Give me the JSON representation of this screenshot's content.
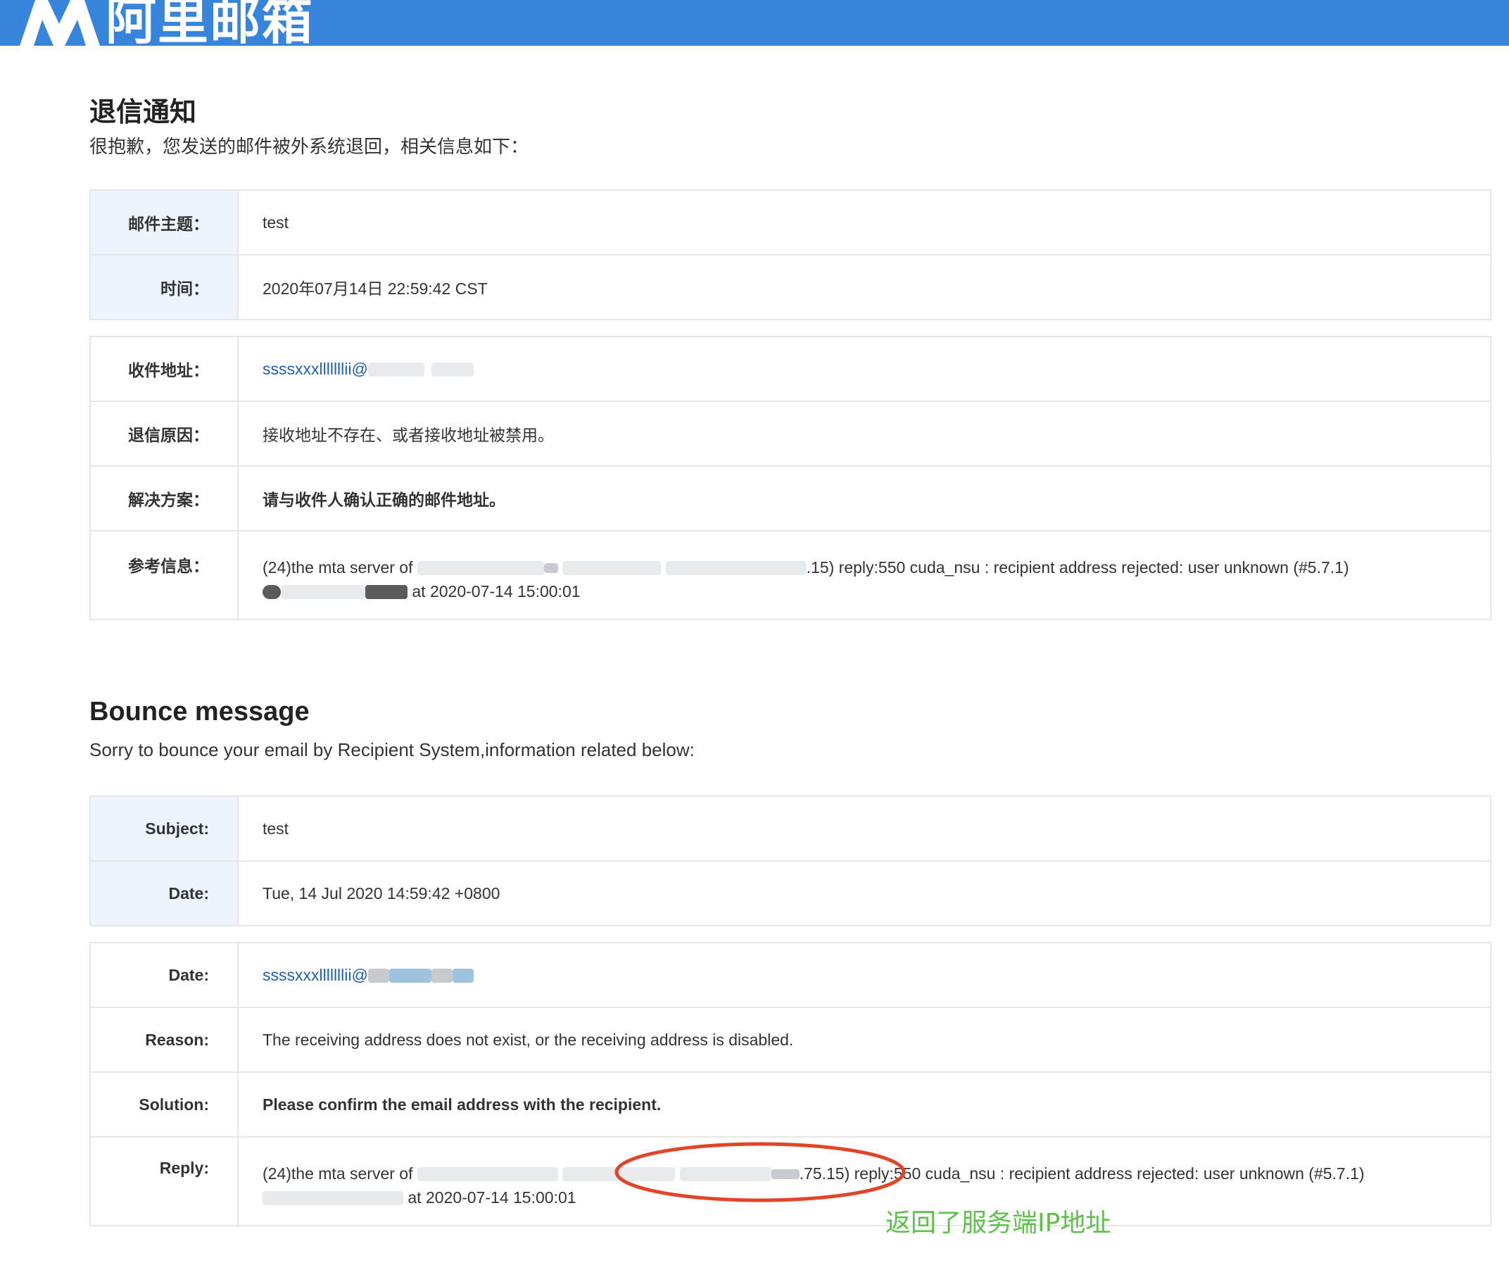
{
  "header": {
    "logo_icon": "aliyun-mail-m-logo",
    "brand": "阿里邮箱",
    "bg_color": "#3784dc"
  },
  "cn": {
    "title": "退信通知",
    "subtitle": "很抱歉，您发送的邮件被外系统退回，相关信息如下：",
    "subject_label": "邮件主题：",
    "subject_value": "test",
    "time_label": "时间：",
    "time_value": "2020年07月14日 22:59:42 CST",
    "recipient_label": "收件地址：",
    "recipient_value": "ssssxxxlllllllii@",
    "reason_label": "退信原因：",
    "reason_value": "接收地址不存在、或者接收地址被禁用。",
    "solution_label": "解决方案：",
    "solution_value": "请与收件人确认正确的邮件地址。",
    "ref_label": "参考信息：",
    "ref_line1_prefix": "(24)the mta server of",
    "ref_line1_ip_tail": ".15)",
    "ref_line1_suffix": "reply:550 cuda_nsu : recipient address rejected: user unknown (#5.7.1)",
    "ref_line2_suffix": "at 2020-07-14 15:00:01"
  },
  "en": {
    "title": "Bounce message",
    "subtitle": "Sorry to bounce your email by Recipient System,information related below:",
    "subject_label": "Subject:",
    "subject_value": "test",
    "date_label": "Date:",
    "date_value": "Tue, 14 Jul 2020 14:59:42 +0800",
    "recipient_label": "Date:",
    "recipient_value": "ssssxxxlllllllii@",
    "reason_label": "Reason:",
    "reason_value": "The receiving address does not exist, or the receiving address is disabled.",
    "solution_label": "Solution:",
    "solution_value": "Please confirm the email address with the recipient.",
    "reply_label": "Reply:",
    "reply_line1_prefix": "(24)the mta server of",
    "reply_line1_ip_tail": ".75.15)",
    "reply_line1_suffix": "reply:550 cuda_nsu : recipient address rejected: user unknown (#5.7.1)",
    "reply_line2_suffix": "at 2020-07-14 15:00:01"
  },
  "annotation": {
    "text": "返回了服务端IP地址",
    "text_color": "#5dc04a",
    "ellipse_color": "#e0452a"
  },
  "colors": {
    "label_bg": "#eef4fd",
    "border": "#e6e6e6",
    "link": "#1f5fb4"
  }
}
